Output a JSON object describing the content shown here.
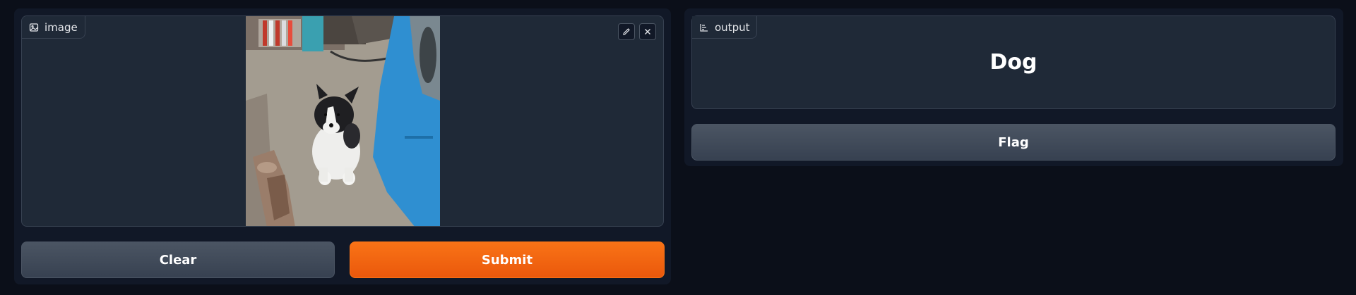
{
  "input_panel": {
    "label": "image",
    "label_icon": "image-icon",
    "tools": [
      {
        "icon": "pencil-icon"
      },
      {
        "icon": "close-icon"
      }
    ],
    "clear_label": "Clear",
    "submit_label": "Submit"
  },
  "output_panel": {
    "label": "output",
    "label_icon": "label-icon",
    "value": "Dog",
    "flag_label": "Flag"
  },
  "colors": {
    "background": "#0b0f19",
    "panel": "#111827",
    "block": "#1f2937",
    "primary": "#f97316",
    "secondary": "#4b5563"
  }
}
